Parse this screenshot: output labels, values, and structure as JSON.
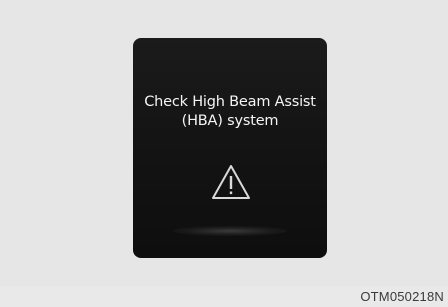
{
  "display": {
    "message_line1": "Check High Beam Assist",
    "message_line2": "(HBA) system",
    "icon": "warning-triangle-icon"
  },
  "figure_code": "OTM050218N"
}
